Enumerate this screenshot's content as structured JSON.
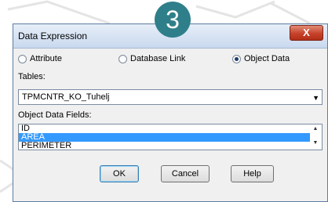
{
  "step": {
    "number": "3"
  },
  "dialog": {
    "title": "Data Expression",
    "close_glyph": "X",
    "radios": [
      {
        "label": "Attribute",
        "checked": false
      },
      {
        "label": "Database Link",
        "checked": false
      },
      {
        "label": "Object Data",
        "checked": true
      }
    ],
    "tables_label": "Tables:",
    "table_value": "TPMCNTR_KO_Tuhelj",
    "fields_label": "Object Data Fields:",
    "fields": [
      "ID",
      "AREA",
      "PERIMETER"
    ],
    "selected_field": "AREA",
    "buttons": {
      "ok": "OK",
      "cancel": "Cancel",
      "help": "Help"
    }
  },
  "colors": {
    "badge": "#2f7f8a",
    "selection": "#3399ff",
    "close": "#c7422a"
  }
}
